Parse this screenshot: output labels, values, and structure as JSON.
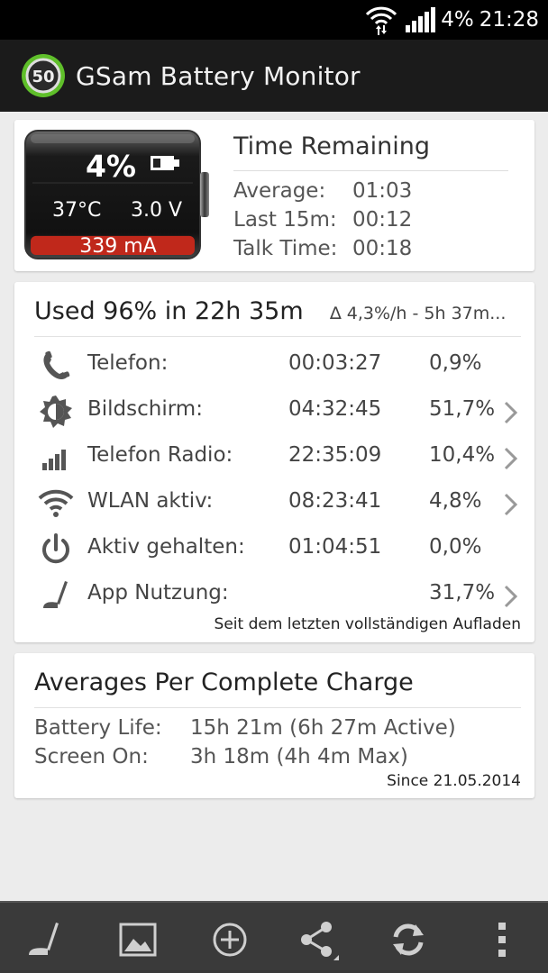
{
  "status_bar": {
    "battery": "4%",
    "time": "21:28"
  },
  "app": {
    "title": "GSam Battery Monitor",
    "icon_number": "50"
  },
  "battery": {
    "percent": "4%",
    "temperature": "37°C",
    "voltage": "3.0 V",
    "current": "339 mA",
    "level_fraction": 0.04
  },
  "time_remaining": {
    "title": "Time Remaining",
    "rows": [
      {
        "label": "Average:",
        "value": "01:03"
      },
      {
        "label": "Last 15m:",
        "value": "00:12"
      },
      {
        "label": "Talk Time:",
        "value": "00:18"
      }
    ]
  },
  "usage": {
    "title": "Used 96% in 22h 35m",
    "rate": "∆ 4,3%/h - 5h 37m...",
    "rows": [
      {
        "icon": "phone-icon",
        "name": "Telefon:",
        "time": "00:03:27",
        "pct": "0,9%",
        "chevron": false
      },
      {
        "icon": "screen-brightness-icon",
        "name": "Bildschirm:",
        "time": "04:32:45",
        "pct": "51,7%",
        "chevron": true
      },
      {
        "icon": "signal-bars-icon",
        "name": "Telefon Radio:",
        "time": "22:35:09",
        "pct": "10,4%",
        "chevron": true
      },
      {
        "icon": "wifi-icon",
        "name": "WLAN aktiv:",
        "time": "08:23:41",
        "pct": "4,8%",
        "chevron": true
      },
      {
        "icon": "power-icon",
        "name": "Aktiv gehalten:",
        "time": "01:04:51",
        "pct": "0,0%",
        "chevron": false
      },
      {
        "icon": "app-usage-icon",
        "name": "App Nutzung:",
        "time": "",
        "pct": "31,7%",
        "chevron": true
      }
    ],
    "footer": "Seit dem letzten vollständigen Aufladen"
  },
  "averages": {
    "title": "Averages Per Complete Charge",
    "rows": [
      {
        "label": "Battery Life:",
        "value": "15h 21m (6h 27m Active)"
      },
      {
        "label": "Screen On:",
        "value": "3h 18m (4h 4m Max)"
      }
    ],
    "footer": "Since 21.05.2014"
  },
  "bottom_bar": {
    "buttons": [
      "app-usage-icon",
      "image-icon",
      "add-circle-icon",
      "share-icon",
      "refresh-icon",
      "overflow-menu-icon"
    ]
  },
  "colors": {
    "battery_fill": "#c0281b",
    "accent_green": "#5fbf2a"
  }
}
